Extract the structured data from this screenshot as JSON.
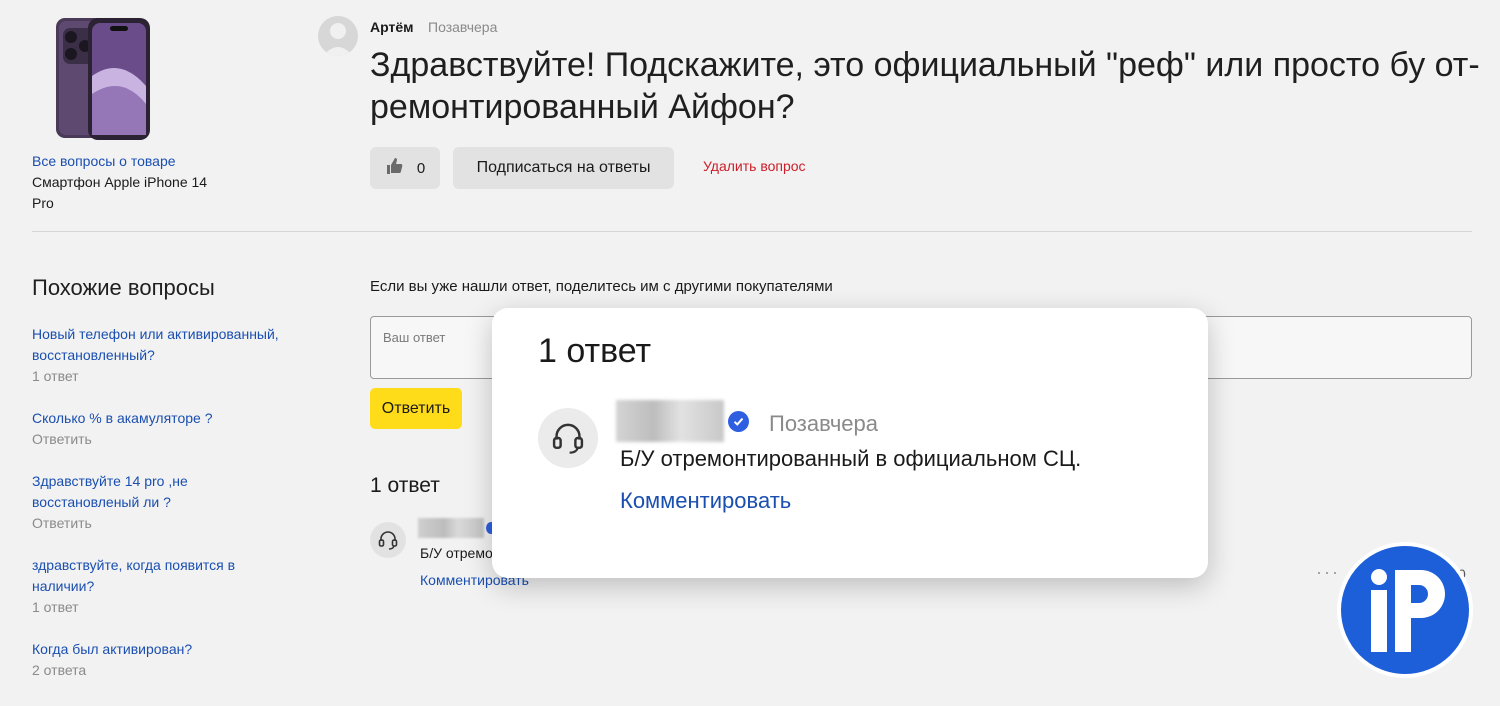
{
  "sidebar": {
    "all_questions_link": "Все вопросы о товаре",
    "product_name": "Смартфон Apple iPhone 14 Pro",
    "similar_title": "Похожие вопросы",
    "similar": [
      {
        "title": "Новый телефон или активированный, восстановленный?",
        "meta": "1 ответ"
      },
      {
        "title": "Сколько % в акамуляторе ?",
        "meta": "Ответить"
      },
      {
        "title": "Здравствуйте 14 pro ,не восстановленый ли ?",
        "meta": "Ответить"
      },
      {
        "title": "здравствуйте, когда появится в наличии?",
        "meta": "1 ответ"
      },
      {
        "title": "Когда был активирован?",
        "meta": "2 ответа"
      }
    ]
  },
  "question": {
    "author": "Артём",
    "date": "Позавчера",
    "text": "Здравствуйте! Подскажите, это официальный \"реф\" или просто бу от-ремонтированный Айфон?",
    "likes": "0",
    "subscribe_label": "Подписаться на ответы",
    "delete_label": "Удалить вопрос"
  },
  "answer_form": {
    "prompt": "Если вы уже нашли ответ, поделитесь им с другими покупателями",
    "placeholder": "Ваш ответ",
    "submit_label": "Ответить"
  },
  "answers": {
    "count_label": "1 ответ",
    "items": [
      {
        "date": "Позавчера",
        "text": "Б/У отремонтированный в официальном СЦ.",
        "comment_label": "Комментировать",
        "text_partial": "Б/У отремо",
        "votes": "0",
        "more": "···"
      }
    ]
  },
  "colors": {
    "accent_yellow": "#ffdc1a",
    "link_blue": "#1a4fb0",
    "delete_red": "#cc1d2a",
    "logo_blue": "#1d5fd8"
  },
  "watermark": {
    "text": "iP"
  }
}
